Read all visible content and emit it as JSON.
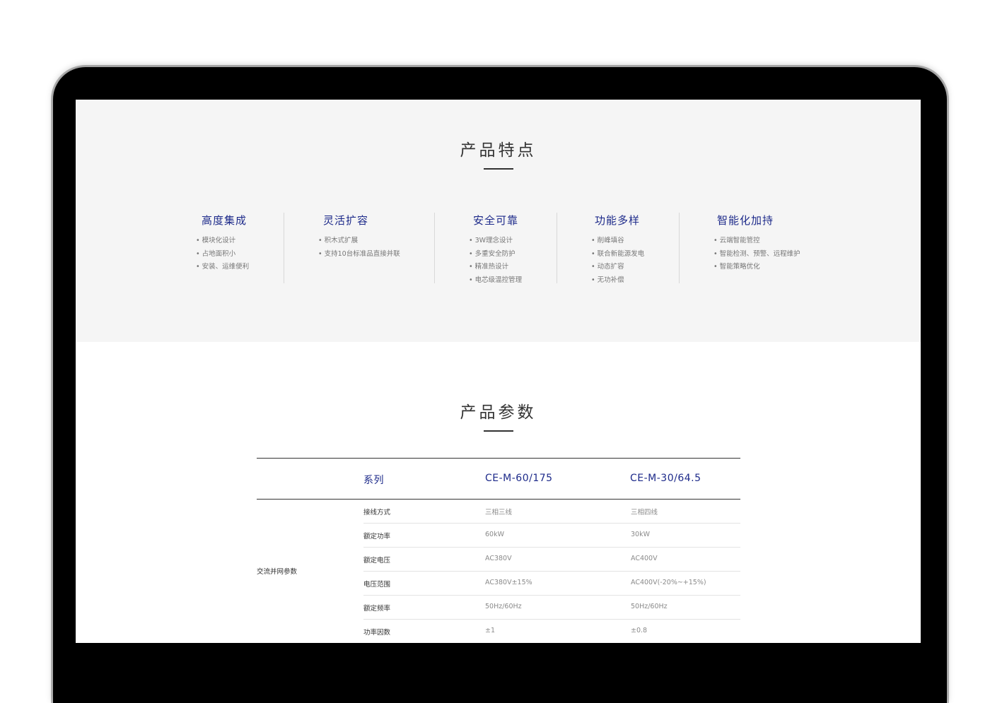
{
  "features_section": {
    "title": "产品特点",
    "columns": [
      {
        "title": "高度集成",
        "items": [
          "• 模块化设计",
          "• 占地面积小",
          "• 安装、运维便利"
        ]
      },
      {
        "title": "灵活扩容",
        "items": [
          "• 积木式扩展",
          "• 支持10台标准品直接并联"
        ]
      },
      {
        "title": "安全可靠",
        "items": [
          "• 3W理念设计",
          "• 多重安全防护",
          "• 精准热设计",
          "• 电芯级温控管理"
        ]
      },
      {
        "title": "功能多样",
        "items": [
          "• 削峰填谷",
          "• 联合新能源发电",
          "• 动态扩容",
          "• 无功补偿"
        ]
      },
      {
        "title": "智能化加持",
        "items": [
          "• 云端智能管控",
          "• 智能检测、预警、远程维护",
          "• 智能策略优化"
        ]
      }
    ]
  },
  "params_section": {
    "title": "产品参数",
    "table": {
      "header": {
        "series_label": "系列",
        "model_1": "CE-M-60/175",
        "model_2": "CE-M-30/64.5"
      },
      "group_label": "交流并网参数",
      "rows": [
        {
          "name": "接线方式",
          "v1": "三相三线",
          "v2": "三相四线"
        },
        {
          "name": "额定功率",
          "v1": "60kW",
          "v2": "30kW"
        },
        {
          "name": "额定电压",
          "v1": "AC380V",
          "v2": "AC400V"
        },
        {
          "name": "电压范围",
          "v1": "AC380V±15%",
          "v2": "AC400V(-20%~+15%)"
        },
        {
          "name": "额定频率",
          "v1": "50Hz/60Hz",
          "v2": "50Hz/60Hz"
        },
        {
          "name": "功率因数",
          "v1": "±1",
          "v2": "±0.8"
        }
      ]
    }
  },
  "colors": {
    "accent": "#1d2a8a",
    "section_bg": "#f5f5f5",
    "bezel": "#000000"
  }
}
